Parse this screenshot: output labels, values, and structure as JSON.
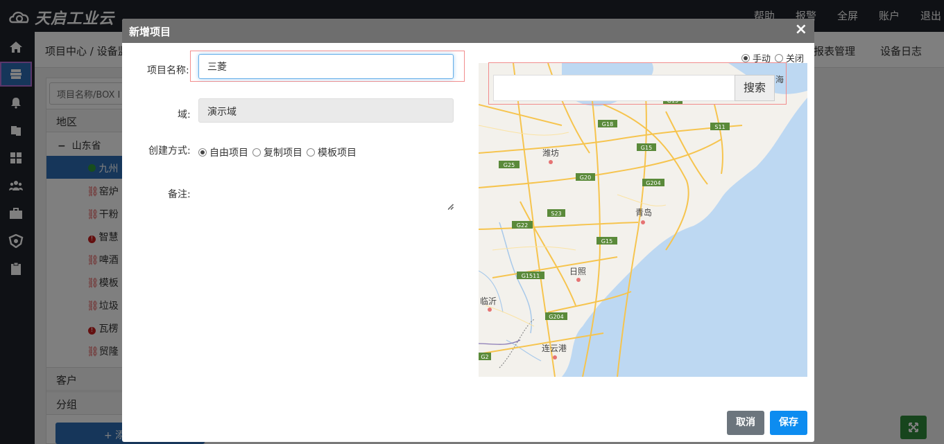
{
  "brand": {
    "logo_text": "天启工业云"
  },
  "top_nav": [
    "帮助",
    "报警",
    "全屏",
    "账户",
    "退出"
  ],
  "breadcrumb": "项目中心 / 设备监",
  "tabs_right": [
    "报表管理",
    "设备日志"
  ],
  "sidebar_icons": [
    "home-icon",
    "project-icon",
    "bell-icon",
    "copy-icon",
    "grid-icon",
    "users-icon",
    "briefcase-icon",
    "shield-icon",
    "clipboard-icon"
  ],
  "left_panel": {
    "search_placeholder": "项目名称/BOX I",
    "region_header": "地区",
    "province": "山东省",
    "items": [
      {
        "label": "九州",
        "status": "online",
        "status_color": "#2e9b3a"
      },
      {
        "label": "窑炉",
        "status": "link-broken",
        "status_color": "#e03a3a"
      },
      {
        "label": "干粉",
        "status": "link-broken",
        "status_color": "#e03a3a"
      },
      {
        "label": "智慧",
        "status": "alarm",
        "status_color": "#c81e1e"
      },
      {
        "label": "啤酒",
        "status": "link-broken",
        "status_color": "#e03a3a"
      },
      {
        "label": "模板",
        "status": "link-broken",
        "status_color": "#e03a3a"
      },
      {
        "label": "垃圾",
        "status": "link-broken",
        "status_color": "#e03a3a"
      },
      {
        "label": "瓦楞",
        "status": "alarm",
        "status_color": "#c81e1e"
      },
      {
        "label": "贸隆",
        "status": "link-broken",
        "status_color": "#e03a3a"
      }
    ],
    "customer_header": "客户",
    "group_header": "分组",
    "add_button": "+ 添"
  },
  "modal": {
    "title": "新增项目",
    "close": "×",
    "fields": {
      "name_label": "项目名称:",
      "name_value": "三菱",
      "domain_label": "域:",
      "domain_value": "演示域",
      "create_label": "创建方式:",
      "create_options": [
        {
          "label": "自由项目",
          "checked": true
        },
        {
          "label": "复制项目",
          "checked": false
        },
        {
          "label": "模板项目",
          "checked": false
        }
      ],
      "notes_label": "备注:"
    },
    "map": {
      "mode_options": [
        {
          "label": "手动",
          "checked": true
        },
        {
          "label": "关闭",
          "checked": false
        }
      ],
      "search_button": "搜索",
      "cities": [
        "潍坊",
        "青岛",
        "日照",
        "临沂",
        "连云港",
        "海"
      ],
      "road_shields": [
        "G18",
        "G15",
        "S11",
        "G25",
        "G20",
        "G204",
        "S23",
        "G22",
        "G15",
        "G1511",
        "G204",
        "G2",
        "G15"
      ]
    },
    "cancel_button": "取消",
    "save_button": "保存"
  },
  "colors": {
    "primary": "#2d6cb5",
    "save": "#0d8cf0",
    "cancel": "#6c757d",
    "highlight": "#f28c8c",
    "sea": "#bdd8f2"
  }
}
